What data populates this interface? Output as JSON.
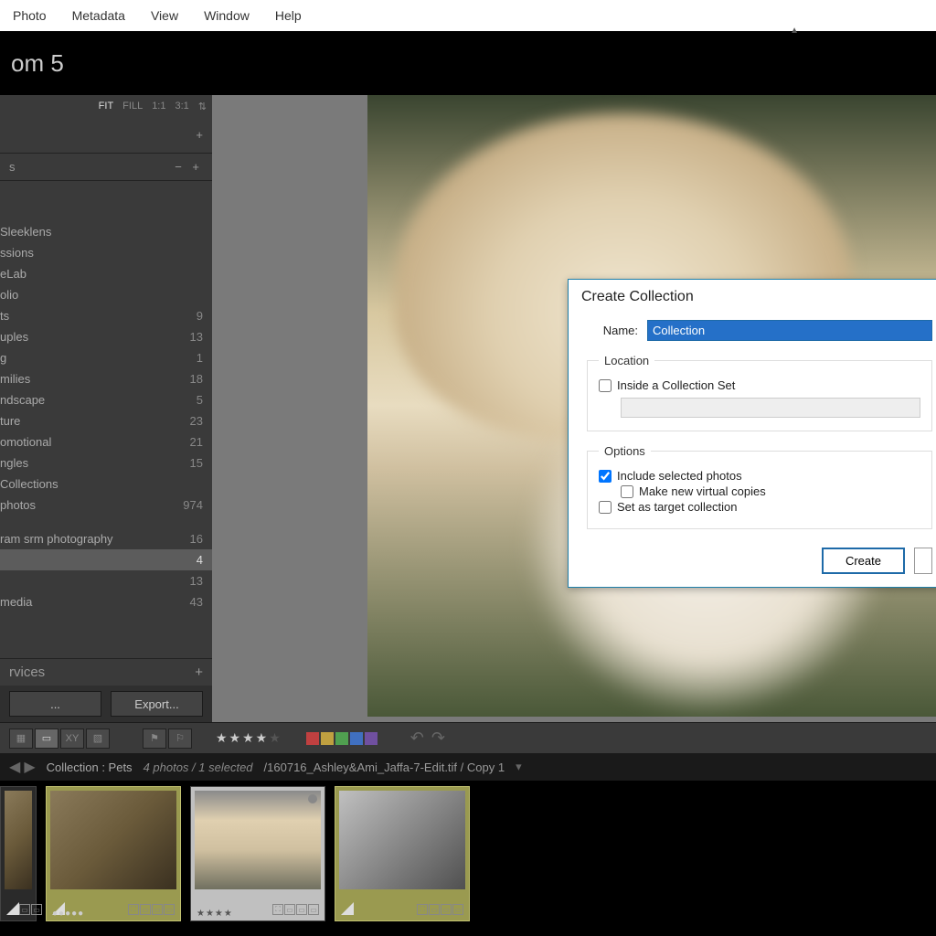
{
  "menubar": {
    "items": [
      "Photo",
      "Metadata",
      "View",
      "Window",
      "Help"
    ]
  },
  "app": {
    "title_suffix": "om 5"
  },
  "zoom": {
    "fit": "FIT",
    "fill": "FILL",
    "r11": "1:1",
    "r31": "3:1"
  },
  "sidebar": {
    "panel_s": "s",
    "items": [
      {
        "label": "Sleeklens",
        "count": ""
      },
      {
        "label": "ssions",
        "count": ""
      },
      {
        "label": "eLab",
        "count": ""
      },
      {
        "label": "olio",
        "count": ""
      },
      {
        "label": "ts",
        "count": "9"
      },
      {
        "label": "uples",
        "count": "13"
      },
      {
        "label": "g",
        "count": "1"
      },
      {
        "label": "milies",
        "count": "18"
      },
      {
        "label": "ndscape",
        "count": "5"
      },
      {
        "label": "ture",
        "count": "23"
      },
      {
        "label": "omotional",
        "count": "21"
      },
      {
        "label": "ngles",
        "count": "15"
      },
      {
        "label": " Collections",
        "count": ""
      },
      {
        "label": " photos",
        "count": "974"
      },
      {
        "label": "",
        "count": ""
      },
      {
        "label": "ram srm photography",
        "count": "16"
      },
      {
        "label": "",
        "count": "4",
        "sel": true
      },
      {
        "label": "",
        "count": "13"
      },
      {
        "label": " media",
        "count": "43"
      }
    ],
    "services_label": "rvices",
    "export_label": "Export..."
  },
  "dialog": {
    "title": "Create Collection",
    "name_label": "Name:",
    "name_value": "Collection",
    "location_legend": "Location",
    "inside_set_label": "Inside a Collection Set",
    "options_legend": "Options",
    "include_label": "Include selected photos",
    "virtual_label": "Make new virtual copies",
    "target_label": "Set as target collection",
    "create_btn": "Create"
  },
  "toolbar": {
    "stars_on": "★★★★",
    "stars_off": "★",
    "colors": [
      "#c04040",
      "#c0a040",
      "#50a050",
      "#4070c0",
      "#7050a0"
    ]
  },
  "filmstrip_info": {
    "collection_label": "Collection : Pets",
    "count_label": "4 photos / 1 selected",
    "filepath": "/160716_Ashley&Ami_Jaffa-7-Edit.tif / Copy 1"
  },
  "thumbs": {
    "t2_stars": "●●●●●",
    "t3_stars": "★★★★"
  }
}
